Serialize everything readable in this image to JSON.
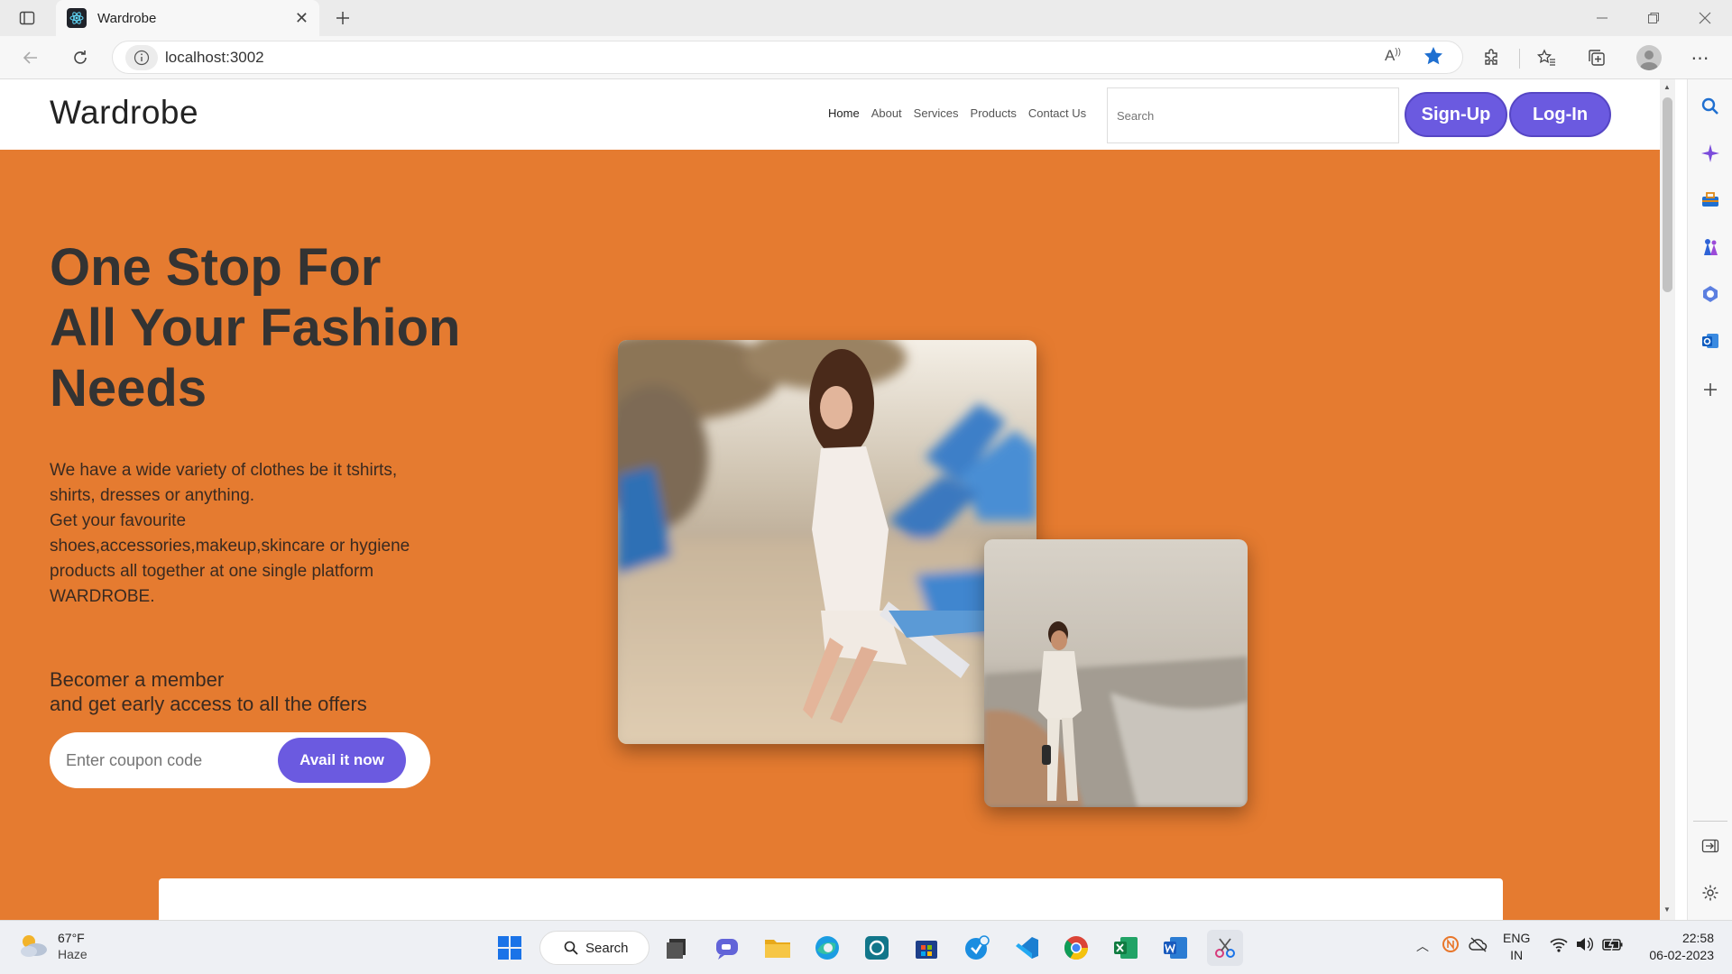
{
  "browser": {
    "tab_title": "Wardrobe",
    "url": "localhost:3002"
  },
  "site": {
    "logo": "Wardrobe",
    "nav": [
      "Home",
      "About",
      "Services",
      "Products",
      "Contact Us"
    ],
    "search_placeholder": "Search",
    "signup_label": "Sign-Up",
    "login_label": "Log-In"
  },
  "hero": {
    "headline": [
      "One Stop For",
      "All Your Fashion",
      "Needs"
    ],
    "description": [
      "We have a wide variety of clothes be it tshirts, shirts, dresses or anything.",
      "Get your favourite shoes,accessories,makeup,skincare or hygiene products all together at one single platform WARDROBE."
    ],
    "member_line1": "Becomer a member",
    "member_line2": "and get early access to all the offers",
    "coupon_placeholder": "Enter coupon code",
    "avail_label": "Avail it now"
  },
  "taskbar": {
    "weather_temp": "67°F",
    "weather_desc": "Haze",
    "search_label": "Search",
    "lang1": "ENG",
    "lang2": "IN",
    "time": "22:58",
    "date": "06-02-2023"
  },
  "colors": {
    "hero_bg": "#e57b30",
    "accent": "#6b5ae0"
  }
}
